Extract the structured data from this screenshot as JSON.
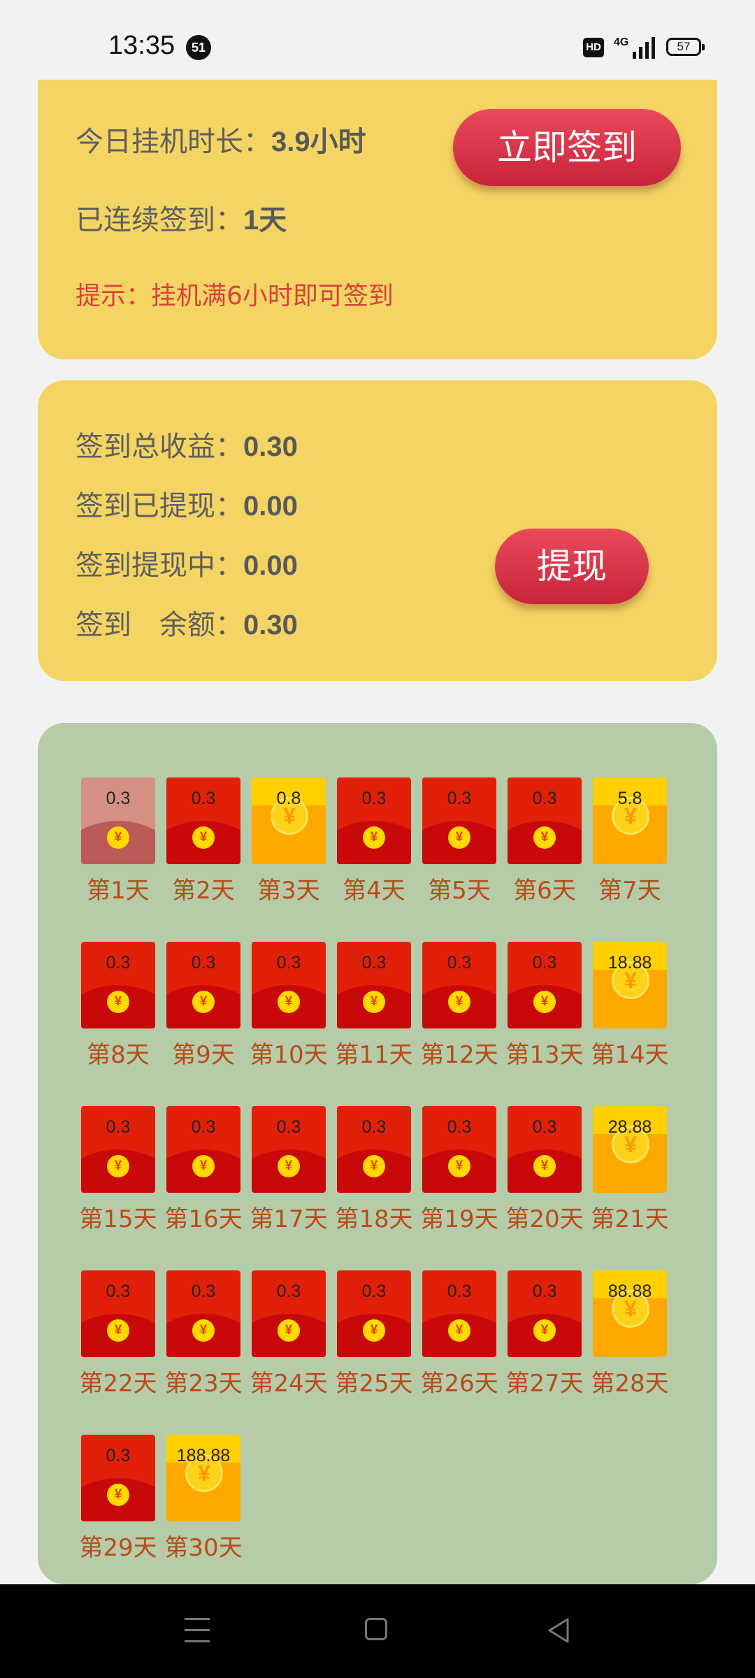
{
  "status_bar": {
    "time": "13:35",
    "notification_count": "51",
    "hd_label": "HD",
    "network": "4G",
    "battery": "57"
  },
  "checkin_card": {
    "hours_label": "今日挂机时长：",
    "hours_value": "3.9小时",
    "streak_label": "已连续签到：",
    "streak_value": "1天",
    "hint": "提示：挂机满6小时即可签到",
    "checkin_button": "立即签到"
  },
  "earnings_card": {
    "total_label": "签到总收益：",
    "total_value": "0.30",
    "withdrawn_label": "签到已提现：",
    "withdrawn_value": "0.00",
    "pending_label": "签到提现中：",
    "pending_value": "0.00",
    "balance_label": "签到　余额：",
    "balance_value": "0.30",
    "withdraw_button": "提现"
  },
  "packets": [
    {
      "amount": "0.3",
      "day": "第1天",
      "style": "faded"
    },
    {
      "amount": "0.3",
      "day": "第2天",
      "style": "red"
    },
    {
      "amount": "0.8",
      "day": "第3天",
      "style": "gold"
    },
    {
      "amount": "0.3",
      "day": "第4天",
      "style": "red"
    },
    {
      "amount": "0.3",
      "day": "第5天",
      "style": "red"
    },
    {
      "amount": "0.3",
      "day": "第6天",
      "style": "red"
    },
    {
      "amount": "5.8",
      "day": "第7天",
      "style": "gold"
    },
    {
      "amount": "0.3",
      "day": "第8天",
      "style": "red"
    },
    {
      "amount": "0.3",
      "day": "第9天",
      "style": "red"
    },
    {
      "amount": "0.3",
      "day": "第10天",
      "style": "red"
    },
    {
      "amount": "0.3",
      "day": "第11天",
      "style": "red"
    },
    {
      "amount": "0.3",
      "day": "第12天",
      "style": "red"
    },
    {
      "amount": "0.3",
      "day": "第13天",
      "style": "red"
    },
    {
      "amount": "18.88",
      "day": "第14天",
      "style": "gold"
    },
    {
      "amount": "0.3",
      "day": "第15天",
      "style": "red"
    },
    {
      "amount": "0.3",
      "day": "第16天",
      "style": "red"
    },
    {
      "amount": "0.3",
      "day": "第17天",
      "style": "red"
    },
    {
      "amount": "0.3",
      "day": "第18天",
      "style": "red"
    },
    {
      "amount": "0.3",
      "day": "第19天",
      "style": "red"
    },
    {
      "amount": "0.3",
      "day": "第20天",
      "style": "red"
    },
    {
      "amount": "28.88",
      "day": "第21天",
      "style": "gold"
    },
    {
      "amount": "0.3",
      "day": "第22天",
      "style": "red"
    },
    {
      "amount": "0.3",
      "day": "第23天",
      "style": "red"
    },
    {
      "amount": "0.3",
      "day": "第24天",
      "style": "red"
    },
    {
      "amount": "0.3",
      "day": "第25天",
      "style": "red"
    },
    {
      "amount": "0.3",
      "day": "第26天",
      "style": "red"
    },
    {
      "amount": "0.3",
      "day": "第27天",
      "style": "red"
    },
    {
      "amount": "88.88",
      "day": "第28天",
      "style": "gold"
    },
    {
      "amount": "0.3",
      "day": "第29天",
      "style": "red"
    },
    {
      "amount": "188.88",
      "day": "第30天",
      "style": "gold"
    }
  ],
  "coin_symbol": "¥",
  "colors": {
    "card_yellow": "#f4d564",
    "card_green": "#b6cca8",
    "button_red": "#d8304a",
    "hint_red": "#d8403c",
    "packet_red": "#e2200a",
    "packet_gold": "#ffa800"
  }
}
